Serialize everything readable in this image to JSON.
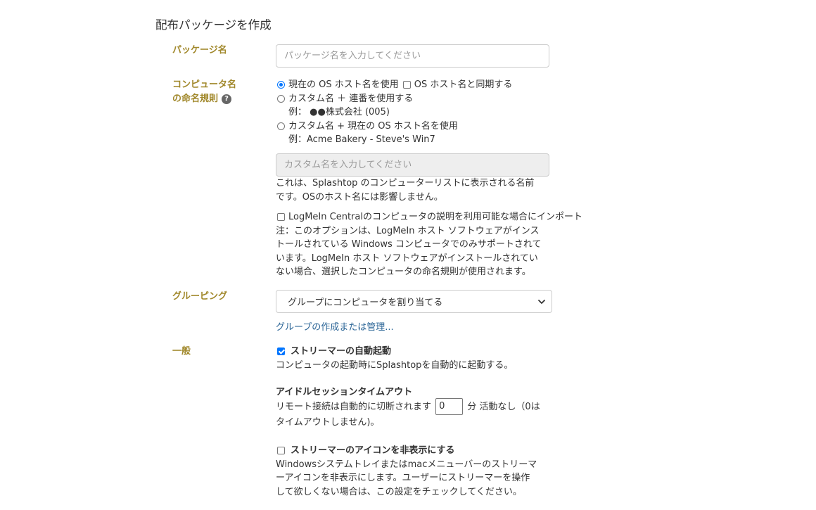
{
  "page": {
    "title": "配布パッケージを作成"
  },
  "package_name": {
    "label": "パッケージ名",
    "placeholder": "パッケージ名を入力してください"
  },
  "naming": {
    "label_line1": "コンピュータ名",
    "label_line2": "の命名規則",
    "help_icon": "question-circle-icon",
    "option1": "現在の OS ホスト名を使用",
    "sync_label": "OS ホスト名と同期する",
    "option2": "カスタム名 ＋ 連番を使用する",
    "option2_example": "例： ●●株式会社 (005)",
    "option3": "カスタム名 + 現在の OS ホスト名を使用",
    "option3_example": "例：Acme Bakery - Steve's Win7",
    "custom_placeholder": "カスタム名を入力してください",
    "note_line1": "これは、Splashtop のコンピューターリストに表示される名前",
    "note_line2": "です。OSのホスト名には影響しません。",
    "import_label": "LogMeIn Centralのコンピュータの説明を利用可能な場合にインポート",
    "import_note_line1": "注：このオプションは、LogMeIn ホスト ソフトウェアがインス",
    "import_note_line2": "トールされている Windows コンピュータでのみサポートされて",
    "import_note_line3": "います。LogMeIn ホスト ソフトウェアがインストールされてい",
    "import_note_line4": "ない場合、選択したコンピュータの命名規則が使用されます。"
  },
  "grouping": {
    "label": "グルーピング",
    "selected": "グループにコンピュータを割り当てる",
    "manage_link": "グループの作成または管理..."
  },
  "general": {
    "label": "一般",
    "autostart_label": "ストリーマーの自動起動",
    "autostart_desc": "コンピュータの起動時にSplashtopを自動的に起動する。",
    "idle_heading": "アイドルセッションタイムアウト",
    "idle_prefix": "リモート接続は自動的に切断されます",
    "idle_value": "0",
    "idle_suffix": "分 活動なし（0は",
    "idle_line2": "タイムアウトしません)。",
    "hide_icon_label": "ストリーマーのアイコンを非表示にする",
    "hide_icon_line1": "Windowsシステムトレイまたはmacメニューバーのストリーマ",
    "hide_icon_line2": "ーアイコンを非表示にします。ユーザーにストリーマーを操作",
    "hide_icon_line3": "して欲しくない場合は、この設定をチェックしてください。"
  }
}
